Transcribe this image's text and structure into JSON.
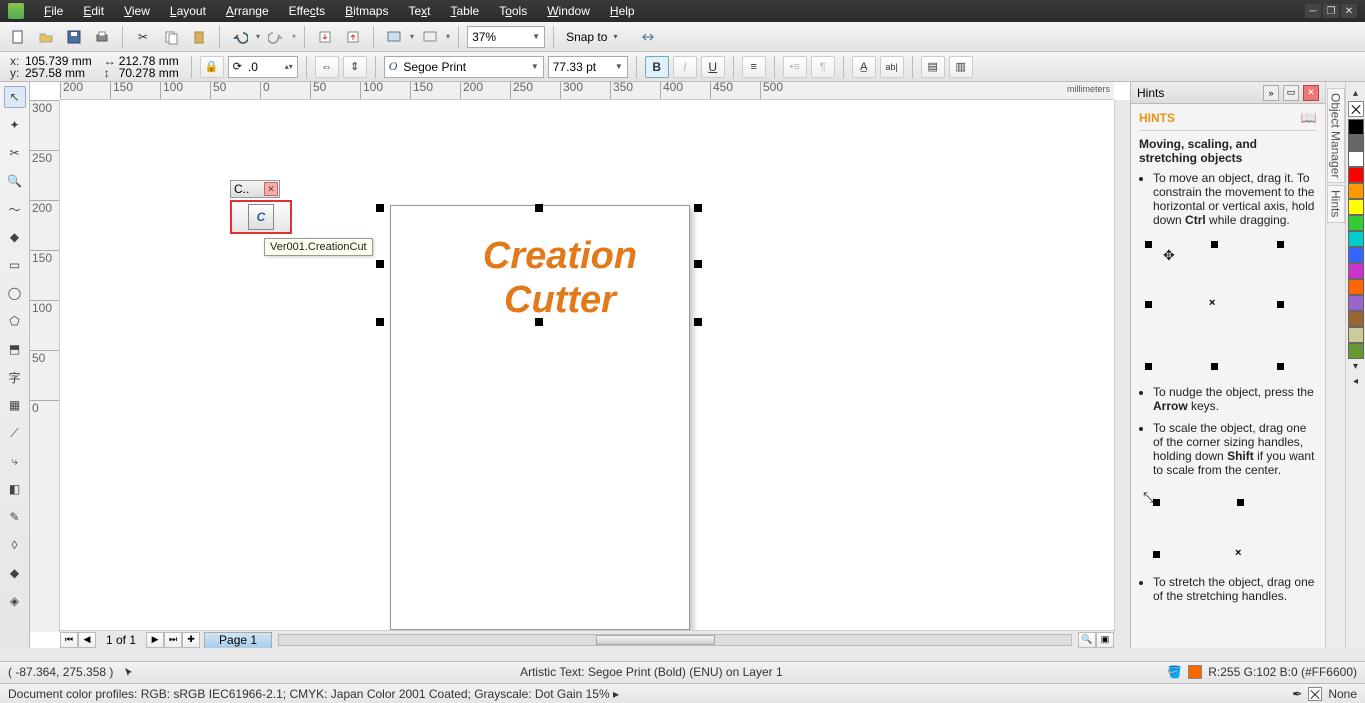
{
  "menu": {
    "items": [
      "File",
      "Edit",
      "View",
      "Layout",
      "Arrange",
      "Effects",
      "Bitmaps",
      "Text",
      "Table",
      "Tools",
      "Window",
      "Help"
    ]
  },
  "toolbar1": {
    "zoom": "37%",
    "snap_label": "Snap to"
  },
  "propbar": {
    "x": "105.739 mm",
    "y": "257.58 mm",
    "w": "212.78 mm",
    "h": "70.278 mm",
    "rotation": ".0",
    "font_name": "Segoe Print",
    "font_size": "77.33 pt"
  },
  "ruler": {
    "h_ticks": [
      "200",
      "150",
      "100",
      "50",
      "0",
      "50",
      "100",
      "150",
      "200",
      "250",
      "300",
      "350",
      "400",
      "450",
      "500"
    ],
    "v_ticks": [
      "300",
      "250",
      "200",
      "150",
      "100",
      "50",
      "0"
    ],
    "unit": "millimeters"
  },
  "plugin": {
    "title": "C..",
    "tooltip": "Ver001.CreationCut",
    "glyph": "C"
  },
  "artistic_text": {
    "line1": "Creation",
    "line2": "Cutter"
  },
  "page_nav": {
    "info": "1 of 1",
    "tab": "Page 1"
  },
  "hints": {
    "tab_label": "Hints",
    "title": "HINTS",
    "subtitle": "Moving, scaling, and stretching objects",
    "p1a": "To move an object, drag it. To constrain the movement to the horizontal or vertical axis, hold down ",
    "p1b": "Ctrl",
    "p1c": " while dragging.",
    "p2a": "To nudge the object, press the ",
    "p2b": "Arrow",
    "p2c": " keys.",
    "p3a": "To scale the object, drag one of the corner sizing handles, holding down ",
    "p3b": "Shift",
    "p3c": " if you want to scale from the center.",
    "p4": "To stretch the object, drag one of the stretching handles."
  },
  "side_tabs": [
    "Object Manager",
    "Hints"
  ],
  "colors": [
    "#000000",
    "#666666",
    "#ffffff",
    "#ff0000",
    "#ff9900",
    "#ffff00",
    "#33cc33",
    "#00cccc",
    "#3366ff",
    "#cc33cc",
    "#ff6600",
    "#9966cc",
    "#996633",
    "#cccc99",
    "#669933"
  ],
  "status1": {
    "coords": "( -87.364, 275.358 )",
    "center": "Artistic Text: Segoe Print (Bold) (ENU) on Layer 1",
    "fill_label": "R:255 G:102 B:0 (#FF6600)"
  },
  "status2": {
    "profiles": "Document color profiles: RGB: sRGB IEC61966-2.1; CMYK: Japan Color 2001 Coated; Grayscale: Dot Gain 15%",
    "outline_label": "None"
  }
}
